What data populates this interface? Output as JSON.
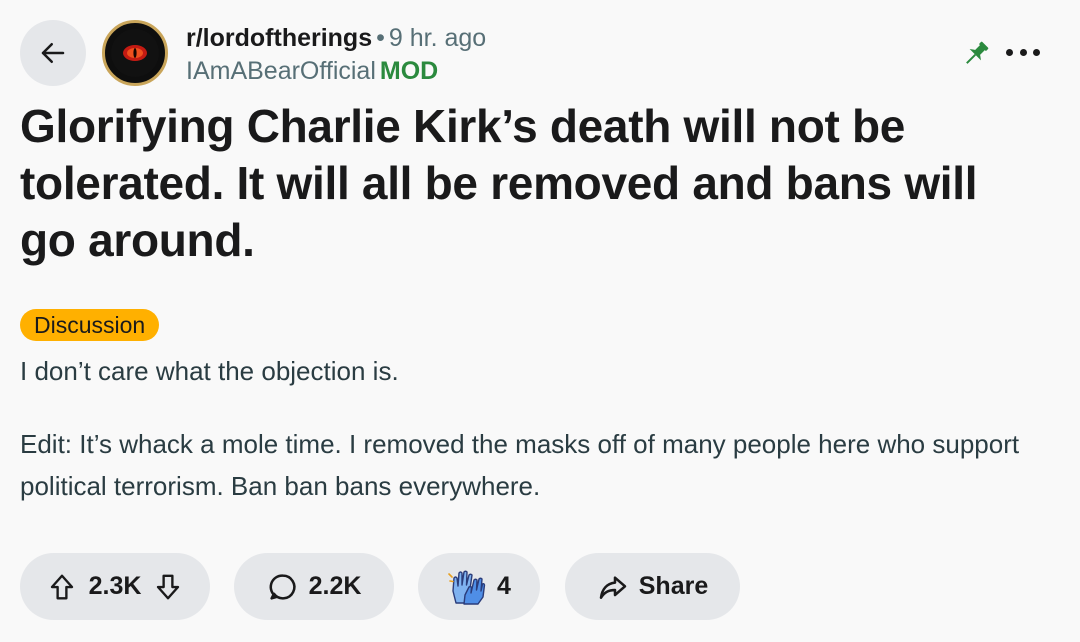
{
  "header": {
    "subreddit": "r/lordoftherings",
    "separator": "•",
    "time_ago": "9 hr. ago",
    "author": "IAmABearOfficial",
    "author_badge": "MOD"
  },
  "icons": {
    "back": "arrow-left-icon",
    "avatar": "eye-of-sauron-avatar",
    "pin": "pin-icon",
    "more": "more-horizontal-icon",
    "upvote": "upvote-arrow-icon",
    "downvote": "downvote-arrow-icon",
    "comment": "comment-bubble-icon",
    "award": "applause-hands-icon",
    "share": "share-arrow-icon"
  },
  "colors": {
    "mod_badge": "#2b8a3e",
    "pin": "#2b8a3e",
    "flair_bg": "#ffb000",
    "button_bg": "#e5e7ea",
    "page_bg": "#f9f9f9"
  },
  "post": {
    "title": "Glorifying Charlie Kirk’s death will not be tolerated. It will all be removed and bans will go around.",
    "flair": "Discussion",
    "body": [
      "I don’t care what the objection is.",
      "Edit: It’s whack a mole time. I removed the masks off of many people here who support political terrorism. Ban ban bans everywhere."
    ]
  },
  "actions": {
    "votes": "2.3K",
    "comments": "2.2K",
    "awards": "4",
    "share_label": "Share"
  }
}
